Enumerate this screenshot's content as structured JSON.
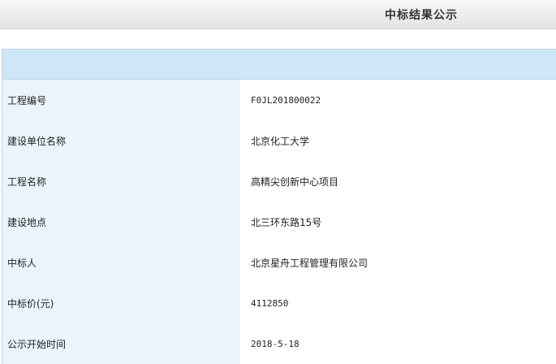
{
  "page": {
    "title": "中标结果公示"
  },
  "rows": [
    {
      "label": "工程编号",
      "value": "F0JL201800022"
    },
    {
      "label": "建设单位名称",
      "value": "北京化工大学"
    },
    {
      "label": "工程名称",
      "value": "高精尖创新中心项目"
    },
    {
      "label": "建设地点",
      "value": "北三环东路15号"
    },
    {
      "label": "中标人",
      "value": "北京星舟工程管理有限公司"
    },
    {
      "label": "中标价(元)",
      "value": "4112850"
    },
    {
      "label": "公示开始时间",
      "value": "2018-5-18"
    }
  ]
}
